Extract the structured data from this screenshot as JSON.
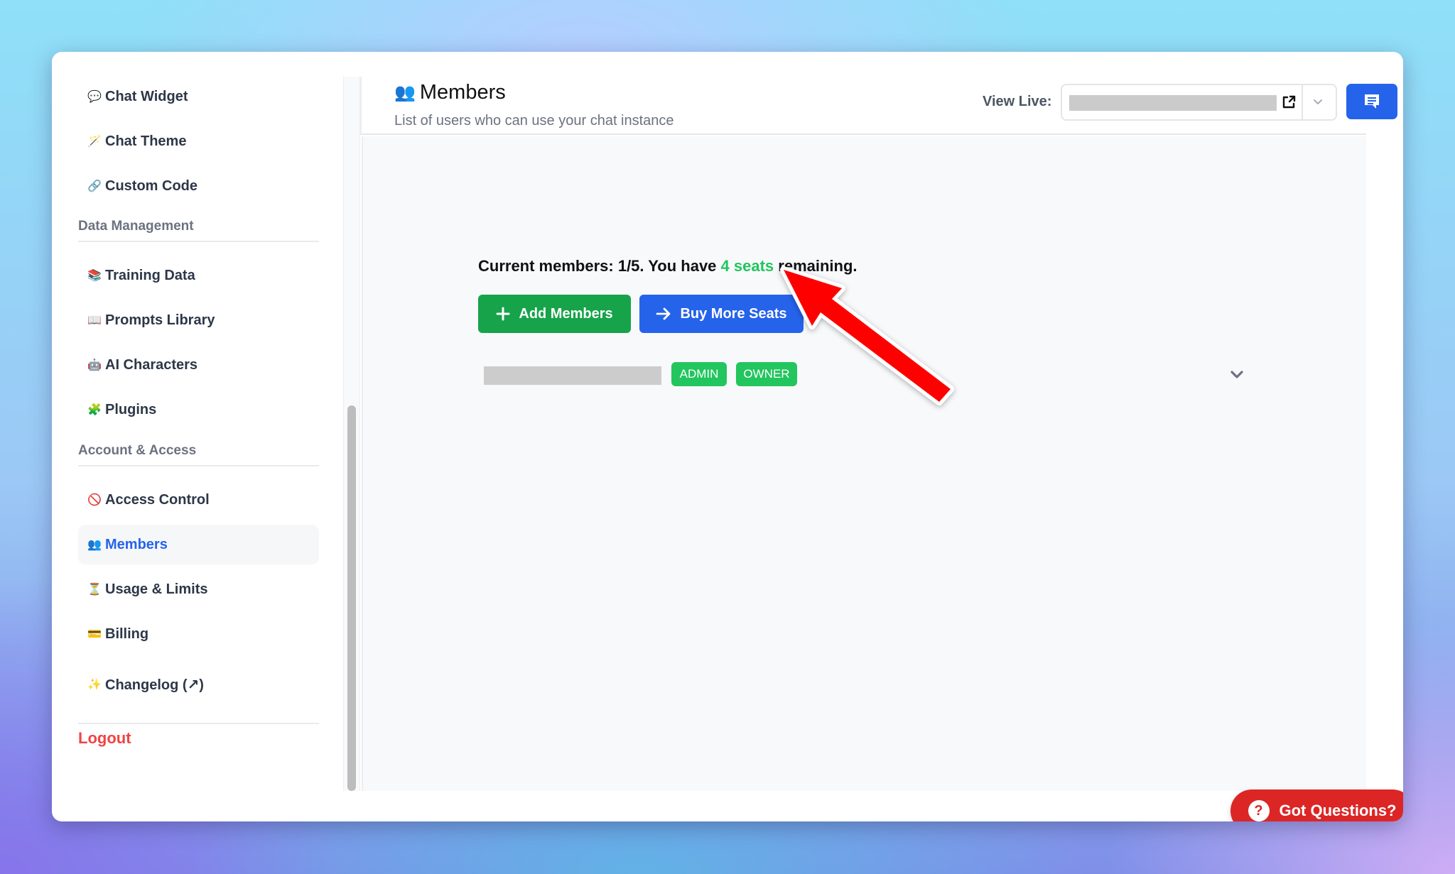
{
  "sidebar": {
    "items_top": [
      {
        "icon": "💬",
        "icon_name": "speech-bubble-icon",
        "label": "Chat Widget"
      },
      {
        "icon": "🪄",
        "icon_name": "magic-wand-icon",
        "label": "Chat Theme"
      },
      {
        "icon": "🔗",
        "icon_name": "link-icon",
        "label": "Custom Code"
      }
    ],
    "section_data": {
      "title": "Data Management",
      "items": [
        {
          "icon": "📚",
          "icon_name": "books-icon",
          "label": "Training Data"
        },
        {
          "icon": "📖",
          "icon_name": "open-book-icon",
          "label": "Prompts Library"
        },
        {
          "icon": "🤖",
          "icon_name": "robot-icon",
          "label": "AI Characters"
        },
        {
          "icon": "🧩",
          "icon_name": "puzzle-icon",
          "label": "Plugins"
        }
      ]
    },
    "section_account": {
      "title": "Account & Access",
      "items": [
        {
          "icon": "🚫",
          "icon_name": "prohibited-icon",
          "label": "Access Control"
        },
        {
          "icon": "👥",
          "icon_name": "users-icon",
          "label": "Members",
          "active": true
        },
        {
          "icon": "⏳",
          "icon_name": "hourglass-icon",
          "label": "Usage & Limits"
        },
        {
          "icon": "💳",
          "icon_name": "credit-card-icon",
          "label": "Billing"
        }
      ]
    },
    "changelog": {
      "icon": "✨",
      "icon_name": "sparkles-icon",
      "label": "Changelog (↗)"
    },
    "logout": "Logout"
  },
  "header": {
    "title_icon": "👥",
    "title": "Members",
    "subtitle": "List of users who can use your chat instance",
    "view_live_label": "View Live:",
    "view_live_value": "[redacted]"
  },
  "main": {
    "summary": {
      "prefix": "Current members: 1/5. You have ",
      "seats": "4 seats",
      "suffix": " remaining."
    },
    "members_current": 1,
    "members_max": 5,
    "add_button": "Add Members",
    "buy_button": "Buy More Seats",
    "members": [
      {
        "email": "[redacted]",
        "badges": [
          "ADMIN",
          "OWNER"
        ]
      }
    ]
  },
  "help_button": "Got Questions?",
  "help_icon": "?",
  "colors": {
    "accent_blue": "#2563eb",
    "success_green": "#16a34a",
    "badge_green": "#22c55e",
    "danger_red": "#dc2626",
    "logout_red": "#ef4444",
    "annotation_arrow": "#ff0000"
  }
}
